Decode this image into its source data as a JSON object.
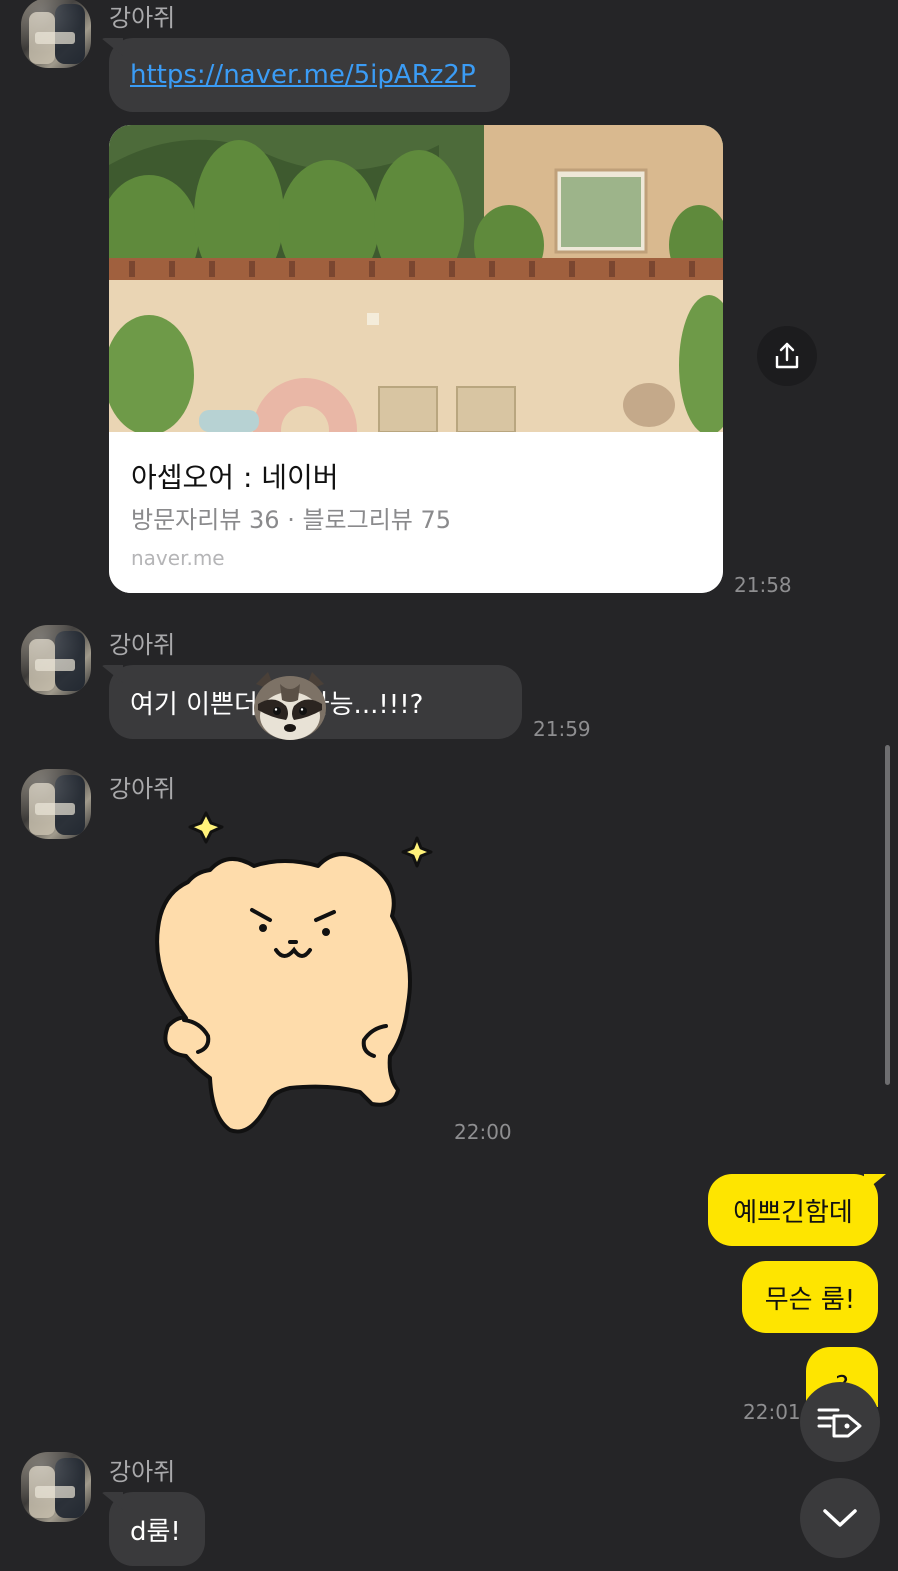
{
  "messages": {
    "m1": {
      "sender": "강아쥐",
      "link": "https://naver.me/5ipARz2P"
    },
    "card": {
      "title": "아셉오어 : 네이버",
      "subtitle": "방문자리뷰 36 · 블로그리뷰 75",
      "domain": "naver.me",
      "time": "21:58"
    },
    "m2": {
      "sender": "강아쥐",
      "text_before": "여기 이쁜더",
      "text_after": "취저가능...!!!?",
      "time": "21:59"
    },
    "m3": {
      "sender": "강아쥐",
      "time": "22:00"
    },
    "mine": {
      "b1": "예쁘긴함데",
      "b2": "무슨 룸!",
      "b3": "?",
      "time": "22:01"
    },
    "m4": {
      "sender": "강아쥐",
      "text": "d룸!"
    }
  },
  "colors": {
    "background": "#252527",
    "bubble": "#3a3a3c",
    "my_bubble": "#fee500",
    "link": "#3b9cf5"
  },
  "icons": [
    "share-icon",
    "tag-menu-icon",
    "chevron-down-icon",
    "raccoon-emoticon",
    "bear-sticker"
  ]
}
